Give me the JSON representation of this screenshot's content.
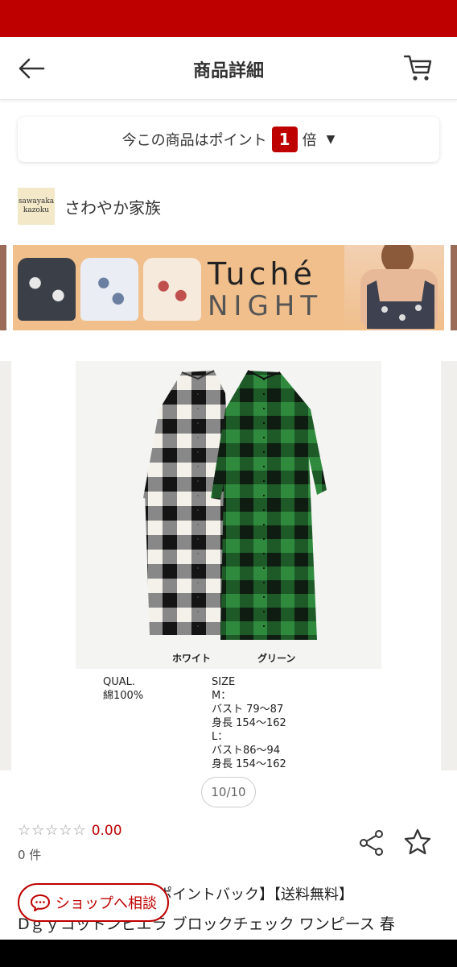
{
  "header": {
    "title": "商品詳細"
  },
  "points": {
    "prefix": "今この商品はポイント",
    "multiplier": "1",
    "suffix": "倍"
  },
  "shop": {
    "logo_line1": "sawayaka",
    "logo_line2": "kazoku",
    "name": "さわやか家族"
  },
  "banner": {
    "brand": "Tuché",
    "subbrand": "NIGHT"
  },
  "photo": {
    "label_white": "ホワイト",
    "label_green": "グリーン",
    "qual_title": "QUAL.",
    "qual_value": "綿100%",
    "size_title": "SIZE",
    "size_m": "M：",
    "size_m_bust": "バスト 79～87",
    "size_m_height": "身長 154～162",
    "size_l": "L：",
    "size_l_bust": "バスト86～94",
    "size_l_height": "身長 154～162"
  },
  "pager": "10/10",
  "rating": {
    "stars": "☆☆☆☆☆",
    "score": "0.00",
    "count": "0 件"
  },
  "product": {
    "title_line1": "ポイントバック】【送料無料】",
    "title_line2": "Dｇｙコットンピエラ ブロックチェック ワンピース 春"
  },
  "consult_button": "ショップへ相談",
  "colors": {
    "accent": "#bf0000"
  }
}
